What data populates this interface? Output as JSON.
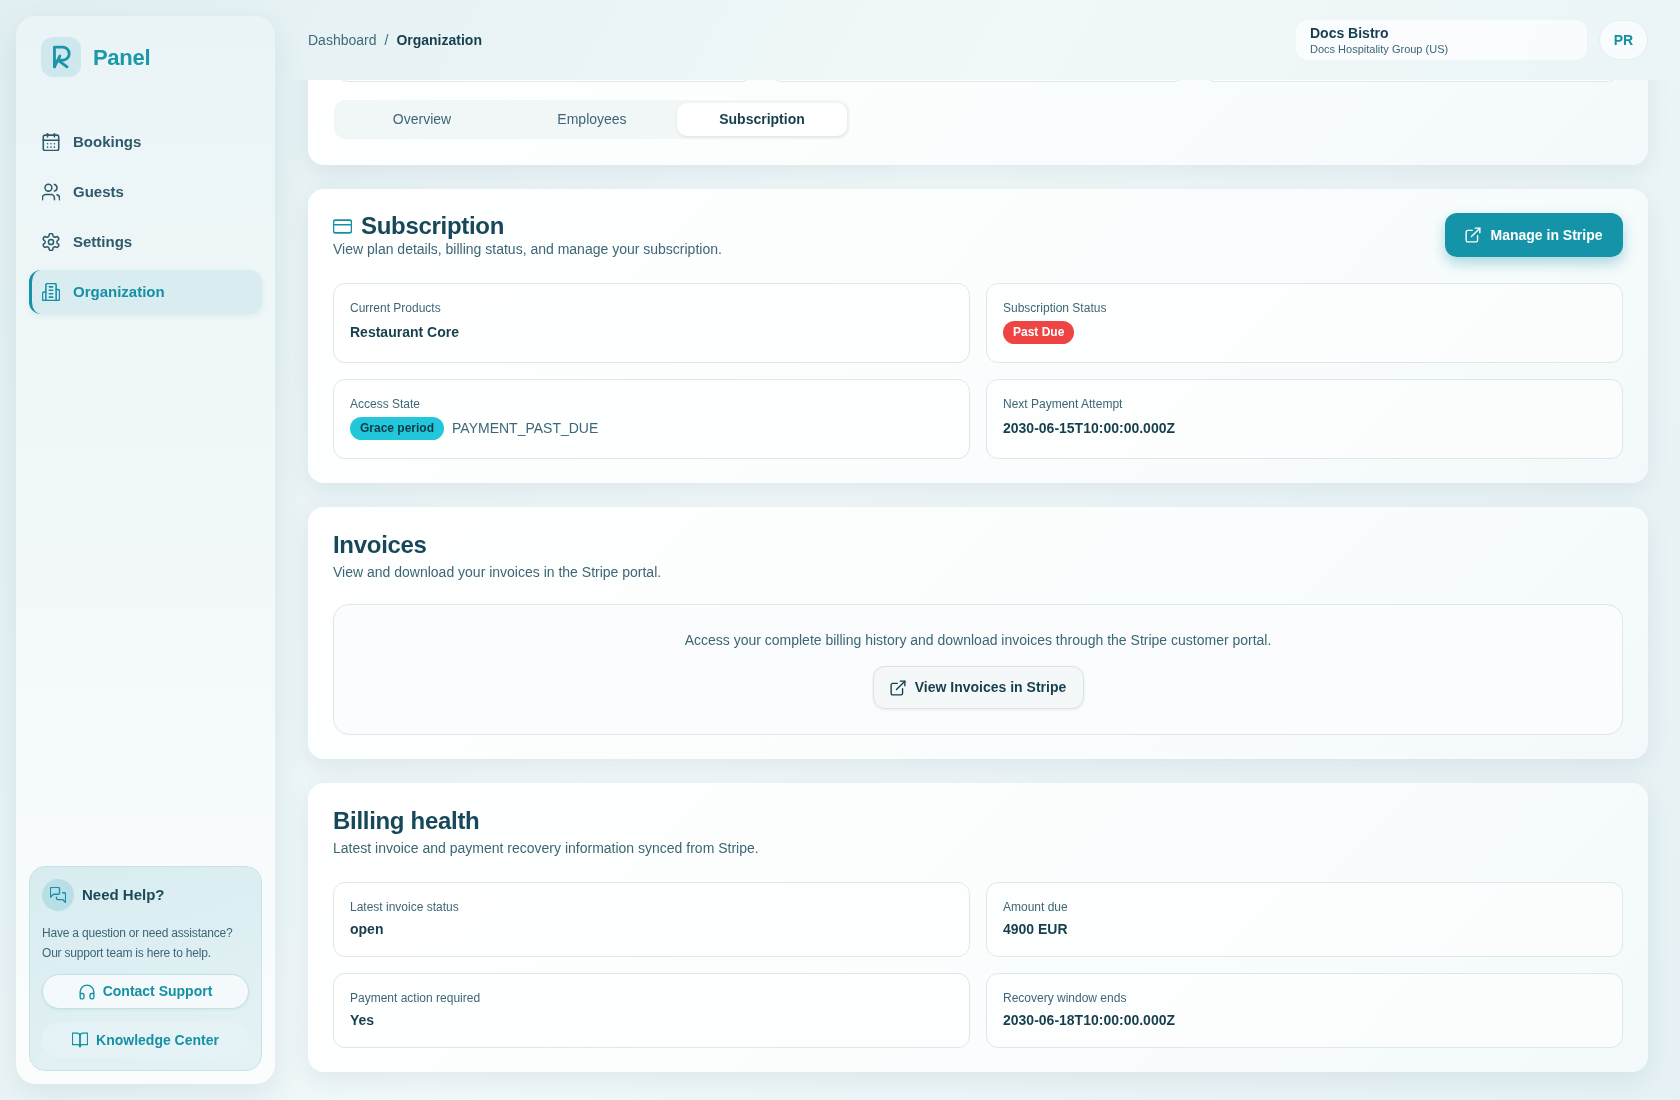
{
  "sidebar": {
    "brand": "Panel",
    "nav": [
      {
        "label": "Bookings",
        "selected": false
      },
      {
        "label": "Guests",
        "selected": false
      },
      {
        "label": "Settings",
        "selected": false
      },
      {
        "label": "Organization",
        "selected": true
      }
    ],
    "help": {
      "title": "Need Help?",
      "text": "Have a question or need assistance? Our support team is here to help.",
      "buttons": [
        {
          "label": "Contact Support",
          "kind": "outline"
        },
        {
          "label": "Knowledge Center",
          "kind": "soft"
        }
      ]
    }
  },
  "header": {
    "breadcrumb": [
      {
        "label": "Dashboard",
        "current": false
      },
      {
        "label": "Organization",
        "current": true
      }
    ],
    "breadcrumb_separator": "/",
    "organization": {
      "name": "Docs Bistro",
      "group": "Docs Hospitality Group (US)"
    },
    "avatar": "PR"
  },
  "tabs": [
    {
      "label": "Overview",
      "selected": false
    },
    {
      "label": "Employees",
      "selected": false
    },
    {
      "label": "Subscription",
      "selected": true
    }
  ],
  "subscription": {
    "title": "Subscription",
    "subtitle": "View plan details, billing status, and manage your subscription.",
    "action": "Manage in Stripe",
    "fields": [
      {
        "label": "Current Products",
        "kind": "text",
        "value": "Restaurant Core"
      },
      {
        "label": "Subscription Status",
        "kind": "badge",
        "badge": "Past Due",
        "color": "#ef4444"
      },
      {
        "label": "Access State",
        "kind": "badge_text",
        "badge": "Grace period",
        "color": "#22c7dc",
        "value": "PAYMENT_PAST_DUE"
      },
      {
        "label": "Next Payment Attempt",
        "kind": "text",
        "value": "2030-06-15T10:00:00.000Z"
      }
    ]
  },
  "invoices": {
    "title": "Invoices",
    "subtitle": "View and download your invoices in the Stripe portal.",
    "note": "Access your complete billing history and download invoices through the Stripe customer portal.",
    "action": "View Invoices in Stripe"
  },
  "billing_health": {
    "title": "Billing health",
    "subtitle": "Latest invoice and payment recovery information synced from Stripe.",
    "fields": [
      {
        "label": "Latest invoice status",
        "kind": "text",
        "value": "open"
      },
      {
        "label": "Amount due",
        "kind": "text",
        "value": "4900 EUR"
      },
      {
        "label": "Payment action required",
        "kind": "text",
        "value": "Yes"
      },
      {
        "label": "Recovery window ends",
        "kind": "text",
        "value": "2030-06-18T10:00:00.000Z"
      }
    ]
  }
}
